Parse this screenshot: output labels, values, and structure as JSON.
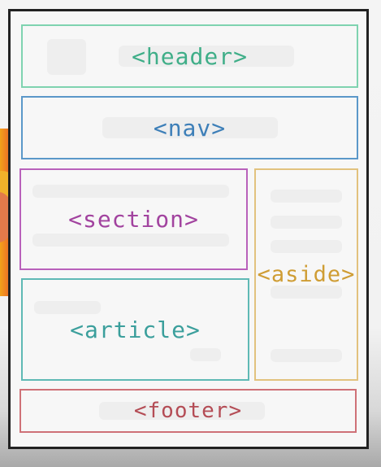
{
  "diagram": {
    "header_label": "<header>",
    "nav_label": "<nav>",
    "section_label": "<section>",
    "aside_label": "<aside>",
    "article_label": "<article>",
    "footer_label": "<footer>"
  },
  "colors": {
    "header": "#3fae88",
    "nav": "#3d7fb8",
    "section": "#a2439f",
    "aside": "#cf9d34",
    "article": "#3b9f9c",
    "footer": "#b44c55",
    "frame": "#222222"
  }
}
